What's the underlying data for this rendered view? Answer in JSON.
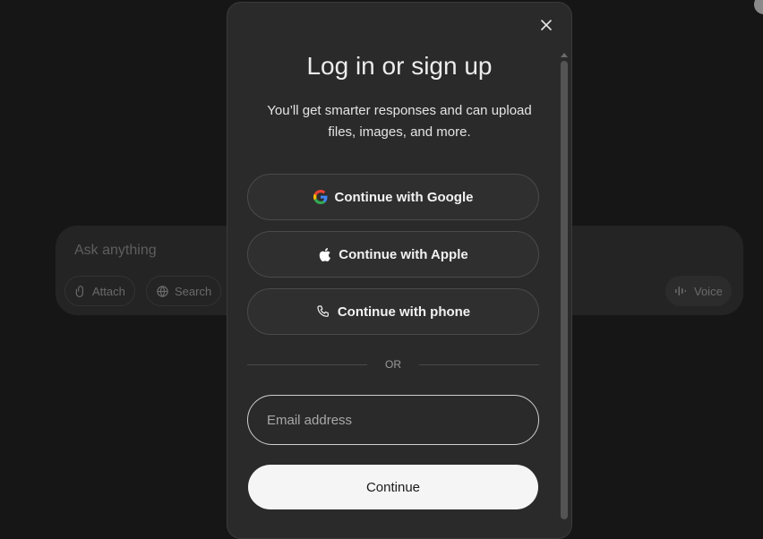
{
  "background": {
    "composer": {
      "placeholder": "Ask anything",
      "attach_label": "Attach",
      "search_label": "Search",
      "voice_label": "Voice"
    }
  },
  "modal": {
    "title": "Log in or sign up",
    "subtitle": "You’ll get smarter responses and can upload files, images, and more.",
    "close_icon": "close-icon",
    "buttons": {
      "google": "Continue with Google",
      "apple": "Continue with Apple",
      "phone": "Continue with phone"
    },
    "divider_text": "OR",
    "email": {
      "placeholder": "Email address",
      "value": ""
    },
    "continue_label": "Continue"
  },
  "colors": {
    "page_bg": "#161616",
    "modal_bg": "#2a2a2a",
    "primary_button_bg": "#f5f5f5",
    "google_blue": "#4285F4",
    "google_red": "#EA4335",
    "google_yellow": "#FBBC05",
    "google_green": "#34A853"
  }
}
